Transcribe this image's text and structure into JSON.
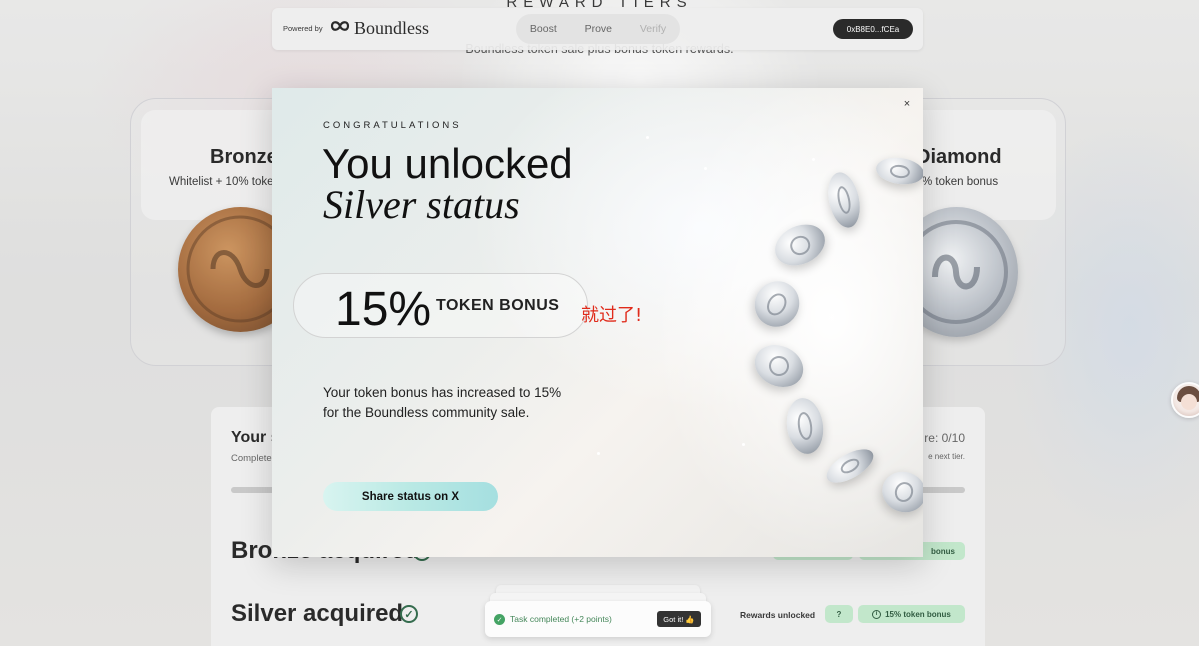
{
  "page": {
    "tiers_heading": "REWARD TIERS",
    "tiers_subtitle": "Boundless token sale plus bonus token rewards."
  },
  "topbar": {
    "powered_by": "Powered by",
    "brand": "Boundless",
    "nav": [
      "Boost",
      "Prove",
      "Verify"
    ],
    "wallet": "0xB8E0...fCEa"
  },
  "tiers": {
    "left": {
      "name": "Bronze",
      "desc": "Whitelist + 10% token bonus"
    },
    "right": {
      "name": "Diamond",
      "desc": "% token bonus"
    }
  },
  "status_panel": {
    "title": "Your s",
    "subtitle": "Complete",
    "score": "re: 0/10",
    "next_tier": "e next tier.",
    "rows": [
      {
        "title": "Bronze acquired",
        "rewards_label": "",
        "pill_unknown": "",
        "pill_bonus": "bonus"
      },
      {
        "title": "Silver acquired",
        "rewards_label": "Rewards unlocked",
        "pill_unknown": "?",
        "pill_bonus": "15% token bonus"
      }
    ]
  },
  "toast": {
    "message": "Task completed (+2 points)",
    "button": "Got it! 👍"
  },
  "modal": {
    "eyebrow": "CONGRATULATIONS",
    "headline": "You unlocked",
    "status": "Silver status",
    "bonus_value": "15%",
    "bonus_label": "TOKEN BONUS",
    "annotation": "就过了!",
    "body": "Your token bonus has increased to 15% for the Boundless community sale.",
    "share_button": "Share status on X",
    "close_symbol": "×"
  },
  "colors": {
    "accent_green": "#bde7c8",
    "annotation_red": "#e02b1b",
    "share_gradient": "#b9e9e4"
  }
}
